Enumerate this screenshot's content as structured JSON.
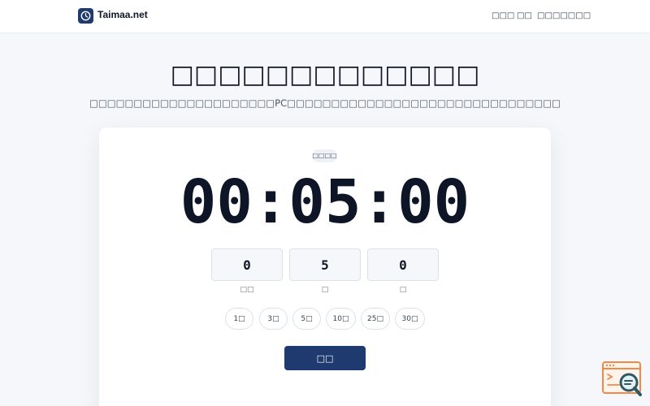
{
  "header": {
    "brand": "Taimaa.net",
    "nav": [
      "□□□",
      "□□",
      "□□□□□□□"
    ]
  },
  "hero": {
    "title": "□□□□□□□□□□□□□",
    "subtitle": "□□□□□□□□□□□□□□□□□□□□□PC□□□□□□□□□□□□□□□□□□□□□□□□□□□□□□□"
  },
  "timer": {
    "badge": "□□□□",
    "display": "00:05:00",
    "fields": [
      {
        "value": "0",
        "label": "□□"
      },
      {
        "value": "5",
        "label": "□"
      },
      {
        "value": "0",
        "label": "□"
      }
    ],
    "presets": [
      "1□",
      "3□",
      "5□",
      "10□",
      "25□",
      "30□"
    ],
    "start_label": "□□"
  },
  "colors": {
    "primary": "#1e3a6e",
    "background": "#f5f7fa",
    "corner_icon": "#f08a4b"
  },
  "icons": {
    "logo": "clock-icon",
    "corner": "search-window-icon"
  }
}
